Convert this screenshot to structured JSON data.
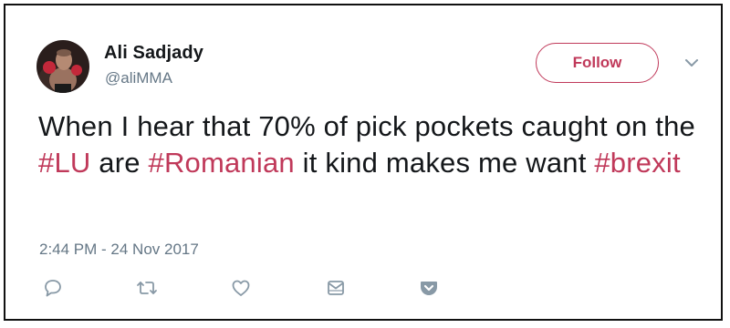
{
  "tweet": {
    "author": {
      "name": "Ali Sadjady",
      "handle": "@aliMMA"
    },
    "follow_label": "Follow",
    "text": [
      {
        "type": "text",
        "value": "When I hear that 70% of pick pockets caught on the "
      },
      {
        "type": "hashtag",
        "value": "#LU"
      },
      {
        "type": "text",
        "value": " are "
      },
      {
        "type": "hashtag",
        "value": "#Romanian"
      },
      {
        "type": "text",
        "value": " it kind makes me want "
      },
      {
        "type": "hashtag",
        "value": "#brexit"
      }
    ],
    "timestamp": "2:44 PM - 24 Nov 2017"
  },
  "actions": [
    {
      "name": "reply-icon"
    },
    {
      "name": "retweet-icon"
    },
    {
      "name": "like-icon"
    },
    {
      "name": "direct-message-icon"
    },
    {
      "name": "pocket-save-icon"
    }
  ],
  "colors": {
    "accent": "#c0395a",
    "text": "#14171a",
    "secondary": "#657786",
    "icon": "#8899a6"
  }
}
